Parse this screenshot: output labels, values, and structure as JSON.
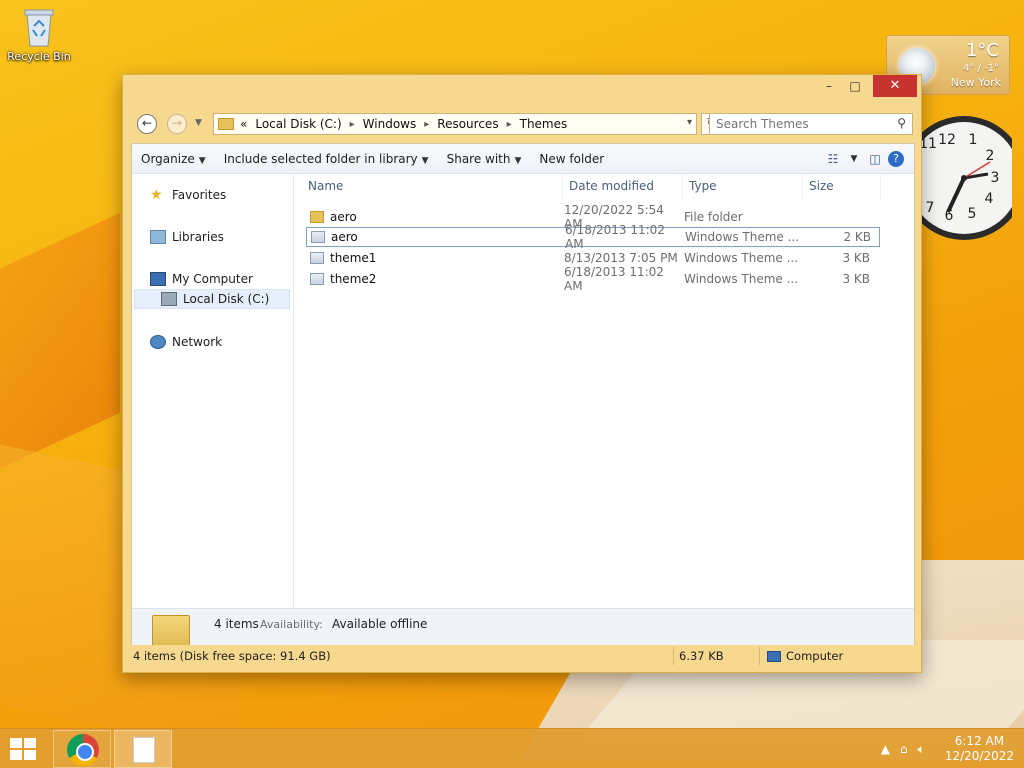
{
  "desktop": {
    "icons": [
      {
        "label": "Recycle Bin",
        "icon": "recycle-bin-icon"
      }
    ]
  },
  "weather": {
    "temperature": "1°C",
    "range": "4° / -1°",
    "city": "New York"
  },
  "clock": {
    "numerals": [
      "11",
      "12",
      "1",
      "2",
      "3",
      "4",
      "5",
      "6",
      "7"
    ]
  },
  "window": {
    "controls": {
      "minimize": "–",
      "maximize": "□",
      "close": "✕"
    },
    "address": {
      "overflow": "«",
      "crumbs": [
        "Local Disk (C:)",
        "Windows",
        "Resources",
        "Themes"
      ]
    },
    "search": {
      "placeholder": "Search Themes"
    },
    "toolbar": {
      "organize": "Organize",
      "include": "Include selected folder in library",
      "share": "Share with",
      "new_folder": "New folder"
    },
    "nav": {
      "favorites": "Favorites",
      "libraries": "Libraries",
      "my_computer": "My Computer",
      "local_disk": "Local Disk (C:)",
      "network": "Network"
    },
    "columns": {
      "name": "Name",
      "date": "Date modified",
      "type": "Type",
      "size": "Size"
    },
    "files": [
      {
        "name": "aero",
        "date": "12/20/2022 5:54 AM",
        "type": "File folder",
        "size": "",
        "icon": "folder-icon"
      },
      {
        "name": "aero",
        "date": "6/18/2013 11:02 AM",
        "type": "Windows Theme ...",
        "size": "2 KB",
        "icon": "theme-file-icon"
      },
      {
        "name": "theme1",
        "date": "8/13/2013 7:05 PM",
        "type": "Windows Theme ...",
        "size": "3 KB",
        "icon": "theme-file-icon"
      },
      {
        "name": "theme2",
        "date": "6/18/2013 11:02 AM",
        "type": "Windows Theme ...",
        "size": "3 KB",
        "icon": "theme-file-icon"
      }
    ],
    "details": {
      "count": "4 items",
      "availability_label": "Availability:",
      "availability_value": "Available offline"
    },
    "status": {
      "left": "4 items (Disk free space: 91.4 GB)",
      "size": "6.37 KB",
      "location": "Computer"
    }
  },
  "taskbar": {
    "apps": [
      "chrome-icon",
      "document-icon"
    ],
    "time": "6:12 AM",
    "date": "12/20/2022"
  },
  "colors": {
    "accent": "#f6d98f",
    "close": "#c7332e",
    "selection": "#7da2ce"
  }
}
